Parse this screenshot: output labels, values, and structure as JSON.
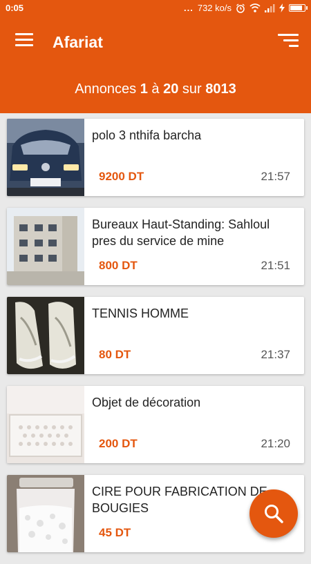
{
  "status": {
    "time": "0:05",
    "dots": "...",
    "network_speed": "732 ko/s",
    "battery_level": 0.9
  },
  "appbar": {
    "title": "Afariat",
    "menu_icon": "hamburger-menu-icon",
    "sort_icon": "sort-icon"
  },
  "summary": {
    "prefix": "Annonces",
    "from": "1",
    "between": "à",
    "to": "20",
    "of": "sur",
    "total": "8013"
  },
  "listings": [
    {
      "title": "polo 3 nthifa barcha",
      "price": "9200 DT",
      "time": "21:57",
      "image": "car-photo"
    },
    {
      "title": "Bureaux Haut-Standing: Sahloul pres du service de mine",
      "price": "800 DT",
      "time": "21:51",
      "image": "building-photo"
    },
    {
      "title": "TENNIS HOMME",
      "price": "80 DT",
      "time": "21:37",
      "image": "sneakers-photo"
    },
    {
      "title": "Objet de décoration",
      "price": "200 DT",
      "time": "21:20",
      "image": "radiator-cover-photo"
    },
    {
      "title": "CIRE POUR FABRICATION DE BOUGIES",
      "price": "45 DT",
      "time": "",
      "image": "wax-jar-photo"
    }
  ],
  "fab": {
    "icon": "search-icon"
  },
  "colors": {
    "accent": "#e4570f",
    "background": "#e9e9e9"
  }
}
